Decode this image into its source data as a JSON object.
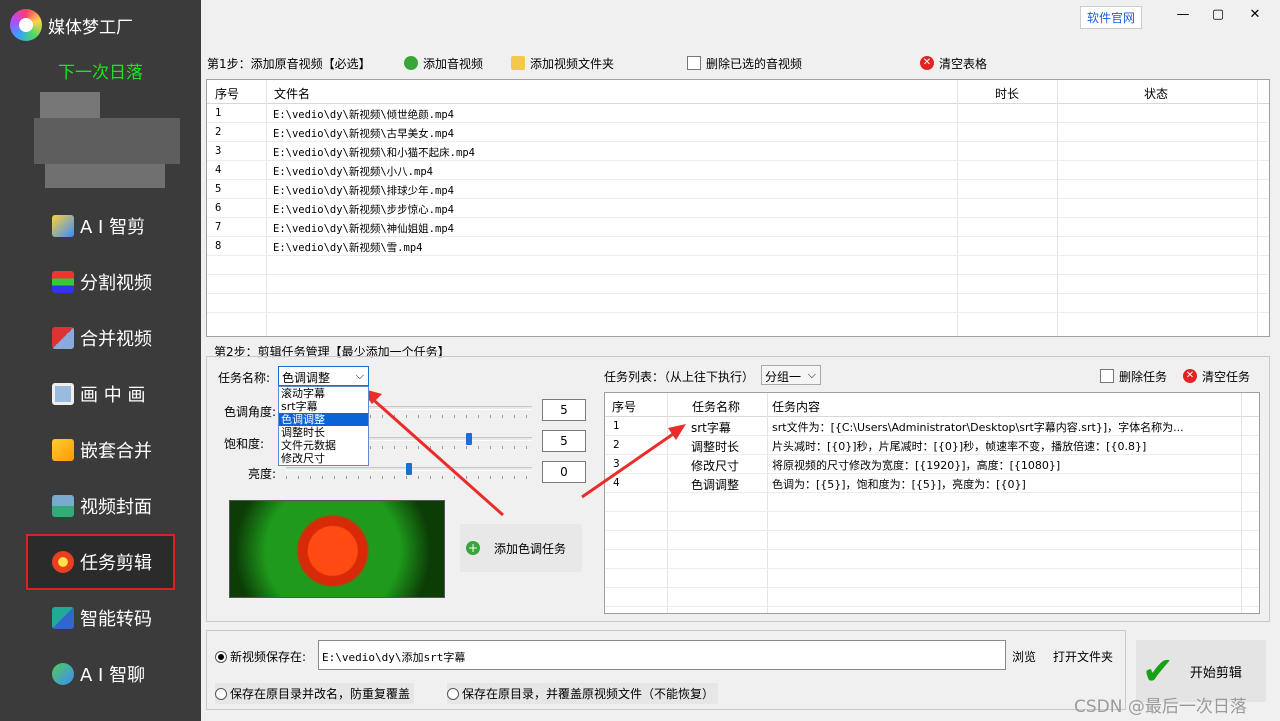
{
  "app": {
    "title": "媒体梦工厂",
    "user_name": "下一次日落",
    "site_link": "软件官网",
    "window_buttons": [
      "—",
      "▢",
      "✕"
    ]
  },
  "sidebar": {
    "items": [
      {
        "label": "A I 智剪",
        "icon": "ai-clip-icon"
      },
      {
        "label": "分割视频",
        "icon": "split-video-icon"
      },
      {
        "label": "合并视频",
        "icon": "merge-video-icon"
      },
      {
        "label": "画 中 画",
        "icon": "pip-icon"
      },
      {
        "label": "嵌套合并",
        "icon": "nest-merge-icon"
      },
      {
        "label": "视频封面",
        "icon": "video-cover-icon"
      },
      {
        "label": "任务剪辑",
        "icon": "task-edit-icon"
      },
      {
        "label": "智能转码",
        "icon": "transcode-icon"
      },
      {
        "label": "A I 智聊",
        "icon": "ai-chat-icon"
      }
    ],
    "active_index": 6
  },
  "step1": {
    "label": "第1步：添加原音视频【必选】",
    "buttons": {
      "add_media": "添加音视频",
      "add_folder": "添加视频文件夹",
      "delete_selected": "删除已选的音视频",
      "clear_table": "清空表格"
    },
    "columns": [
      "序号",
      "文件名",
      "时长",
      "状态"
    ],
    "rows": [
      {
        "idx": "1",
        "file": "E:\\vedio\\dy\\新视频\\倾世绝颜.mp4"
      },
      {
        "idx": "2",
        "file": "E:\\vedio\\dy\\新视频\\古早美女.mp4"
      },
      {
        "idx": "3",
        "file": "E:\\vedio\\dy\\新视频\\和小猫不起床.mp4"
      },
      {
        "idx": "4",
        "file": "E:\\vedio\\dy\\新视频\\小八.mp4"
      },
      {
        "idx": "5",
        "file": "E:\\vedio\\dy\\新视频\\排球少年.mp4"
      },
      {
        "idx": "6",
        "file": "E:\\vedio\\dy\\新视频\\步步惊心.mp4"
      },
      {
        "idx": "7",
        "file": "E:\\vedio\\dy\\新视频\\神仙姐姐.mp4"
      },
      {
        "idx": "8",
        "file": "E:\\vedio\\dy\\新视频\\雪.mp4"
      }
    ]
  },
  "step2": {
    "label": "第2步：剪辑任务管理【最少添加一个任务】",
    "task_name_label": "任务名称:",
    "task_selected": "色调调整",
    "task_options": [
      "滚动字幕",
      "srt字幕",
      "色调调整",
      "调整时长",
      "文件元数据",
      "修改尺寸"
    ],
    "hue_label": "色调角度:",
    "saturation_label": "饱和度:",
    "brightness_label": "亮度:",
    "hue_value": "5",
    "saturation_value": "5",
    "brightness_value": "0",
    "add_task_button": "添加色调任务",
    "task_list_label": "任务列表：（从上往下执行）",
    "group_select": "分组一",
    "delete_task": "删除任务",
    "clear_task": "清空任务",
    "task_columns": [
      "序号",
      "任务名称",
      "任务内容"
    ],
    "tasks": [
      {
        "idx": "1",
        "name": "srt字幕",
        "content": "srt文件为：[{C:\\Users\\Administrator\\Desktop\\srt字幕内容.srt}]，字体名称为..."
      },
      {
        "idx": "2",
        "name": "调整时长",
        "content": "片头减时：[{0}]秒，片尾减时：[{0}]秒，帧速率不变，播放倍速：[{0.8}]"
      },
      {
        "idx": "3",
        "name": "修改尺寸",
        "content": "将原视频的尺寸修改为宽度：[{1920}]，高度：[{1080}]"
      },
      {
        "idx": "4",
        "name": "色调调整",
        "content": "色调为：[{5}]，饱和度为：[{5}]，亮度为：[{0}]"
      }
    ]
  },
  "output": {
    "save_new_label": "新视频保存在:",
    "save_path": "E:\\vedio\\dy\\添加srt字幕",
    "browse": "浏览",
    "open_folder": "打开文件夹",
    "rename_option": "保存在原目录并改名，防重复覆盖",
    "overwrite_option": "保存在原目录，并覆盖原视频文件（不能恢复）",
    "start_button": "开始剪辑"
  },
  "watermark": "CSDN @最后一次日落",
  "slider_levels": {
    "hue": 0.25,
    "saturation": 0.75,
    "brightness": 0.5
  }
}
